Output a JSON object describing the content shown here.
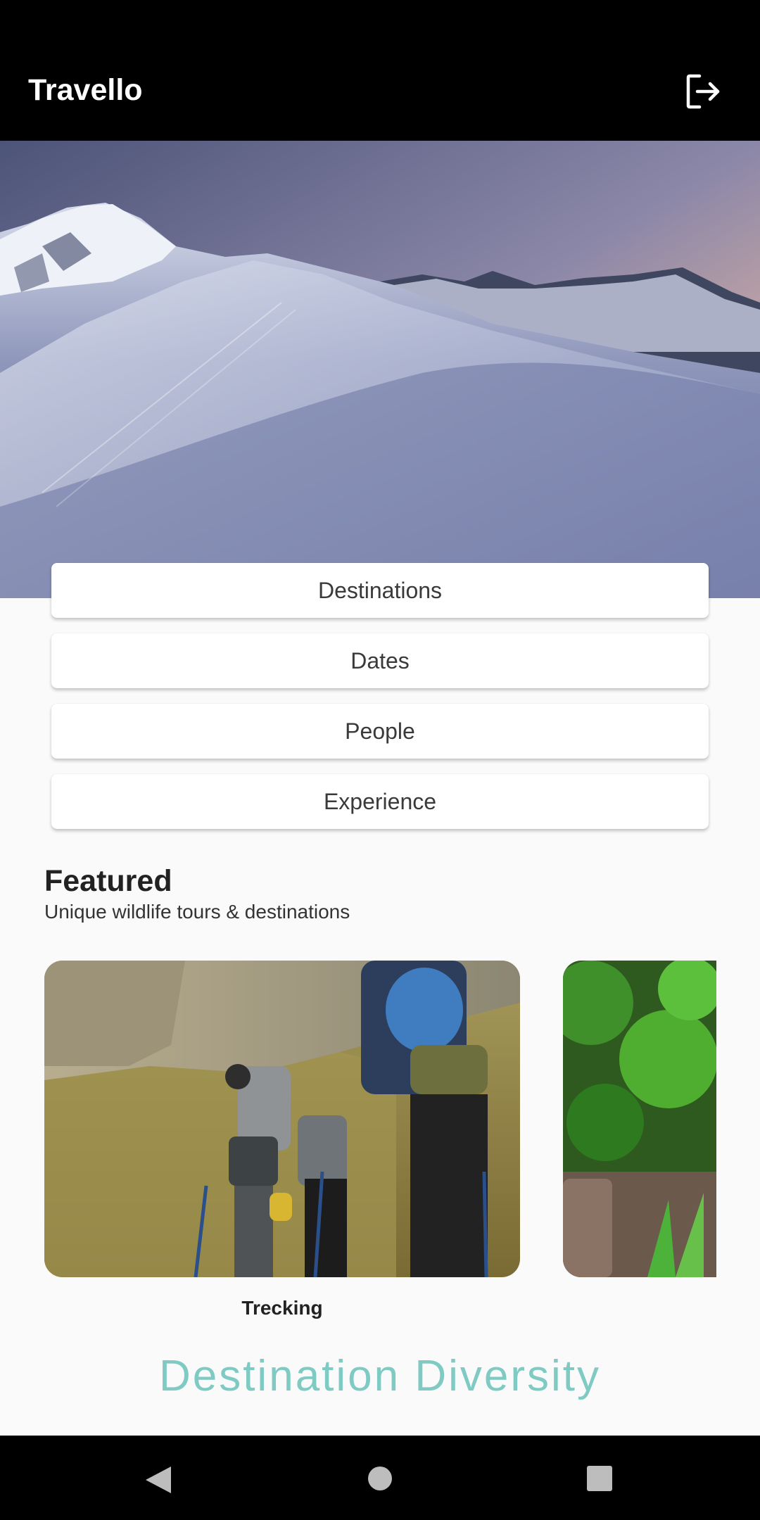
{
  "app": {
    "title": "Travello"
  },
  "menu": {
    "items": [
      {
        "label": "Destinations"
      },
      {
        "label": "Dates"
      },
      {
        "label": "People"
      },
      {
        "label": "Experience"
      }
    ]
  },
  "featured": {
    "title": "Featured",
    "subtitle": "Unique wildlife tours & destinations",
    "cards": [
      {
        "label": "Trecking"
      }
    ]
  },
  "section": {
    "heading": "Destination Diversity"
  },
  "icons": {
    "logout": "logout-icon",
    "back": "back-triangle-icon",
    "home": "home-circle-icon",
    "recents": "recents-square-icon"
  },
  "colors": {
    "accent": "#7fcbc4",
    "appbar": "#000000"
  }
}
